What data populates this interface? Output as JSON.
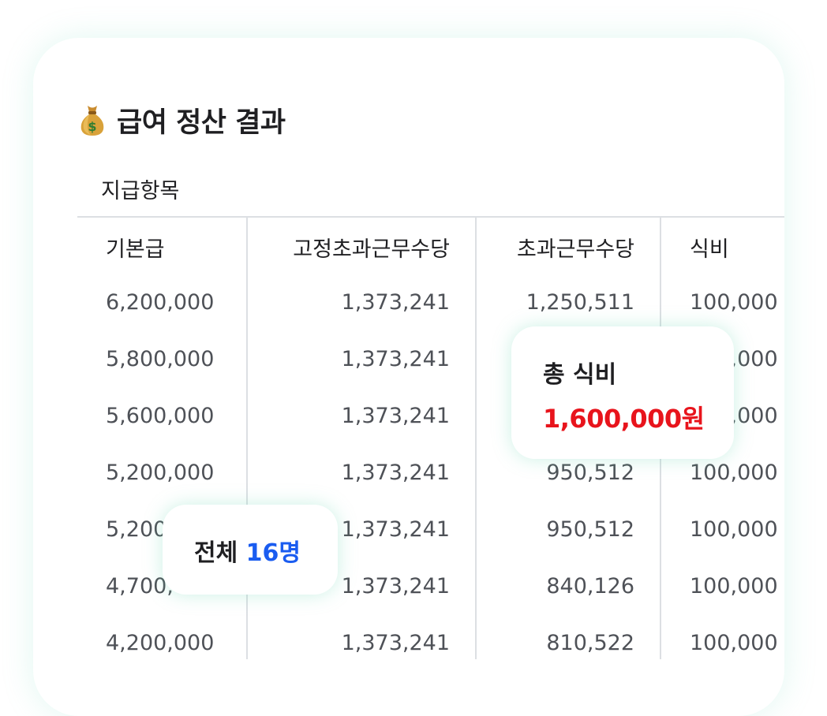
{
  "title": "급여 정산 결과",
  "icon": "money-bag-icon",
  "section_label": "지급항목",
  "table": {
    "headers": [
      "기본급",
      "고정초과근무수당",
      "초과근무수당",
      "식비"
    ],
    "rows": [
      [
        "6,200,000",
        "1,373,241",
        "1,250,511",
        "100,000"
      ],
      [
        "5,800,000",
        "1,373,241",
        "",
        "100,000"
      ],
      [
        "5,600,000",
        "1,373,241",
        "",
        "100,000"
      ],
      [
        "5,200,000",
        "1,373,241",
        "950,512",
        "100,000"
      ],
      [
        "5,200,000",
        "1,373,241",
        "950,512",
        "100,000"
      ],
      [
        "4,700,000",
        "1,373,241",
        "840,126",
        "100,000"
      ],
      [
        "4,200,000",
        "1,373,241",
        "810,522",
        "100,000"
      ]
    ]
  },
  "meal_popup": {
    "label": "총 식비",
    "value": "1,600,000원"
  },
  "count_popup": {
    "label": "전체",
    "value": "16명"
  },
  "colors": {
    "accent_red": "#e8141c",
    "accent_blue": "#1a5cf0",
    "divider": "#dcdfe3"
  }
}
